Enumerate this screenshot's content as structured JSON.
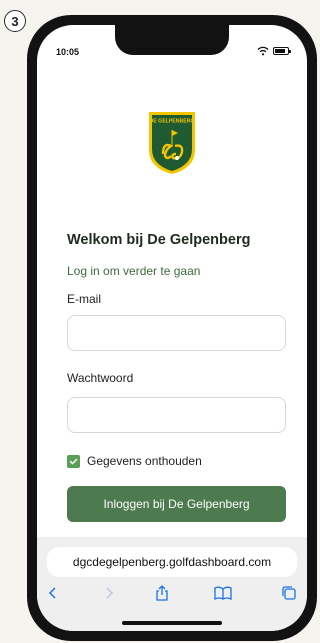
{
  "step": {
    "number": "3"
  },
  "status_bar": {
    "time": "10:05"
  },
  "logo": {
    "text": "DE GELPENBERG"
  },
  "login": {
    "title": "Welkom bij De Gelpenberg",
    "subtitle": "Log in om verder te gaan",
    "email_label": "E-mail",
    "email_value": "",
    "password_label": "Wachtwoord",
    "password_value": "",
    "remember_label": "Gegevens onthouden",
    "remember_checked": true,
    "submit_label": "Inloggen bij De Gelpenberg"
  },
  "browser": {
    "url": "dgcdegelpenberg.golfdashboard.com",
    "nav": [
      "back-icon",
      "forward-icon",
      "share-icon",
      "bookmarks-icon",
      "tabs-icon"
    ]
  },
  "colors": {
    "accent_green": "#4d7a4e",
    "subtitle_green": "#3b6e3b",
    "checkbox_green": "#58a055",
    "ios_blue": "#1a73e8"
  }
}
